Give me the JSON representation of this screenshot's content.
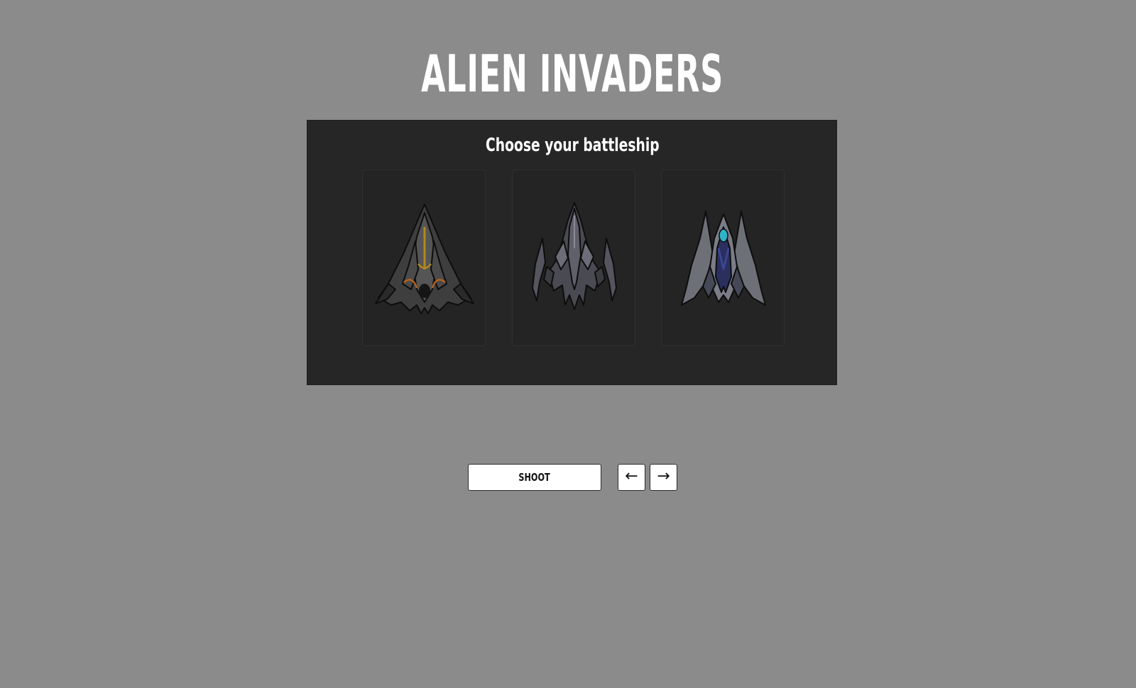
{
  "game": {
    "title": "ALIEN INVADERS"
  },
  "ship_select": {
    "heading": "Choose your battleship",
    "ships": [
      {
        "id": "ship-1",
        "accent": "#b3891f"
      },
      {
        "id": "ship-2",
        "accent": "#6d6d7a"
      },
      {
        "id": "ship-3",
        "accent": "#2fb3c9"
      }
    ]
  },
  "controls": {
    "shoot_label": "SHOOT",
    "left_label": "←",
    "right_label": "→"
  },
  "colors": {
    "background": "#8b8b8b",
    "panel": "#262626",
    "button": "#ffffff"
  }
}
